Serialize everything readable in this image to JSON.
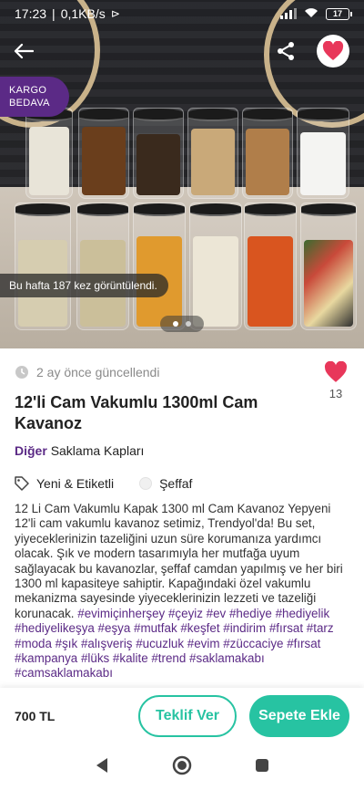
{
  "status_bar": {
    "time": "17:23",
    "speed": "0,1KB/s",
    "battery": "17"
  },
  "hero": {
    "badge_line1": "KARGO",
    "badge_line2": "BEDAVA",
    "views_text": "Bu hafta 187 kez görüntülendi.",
    "pages": 2,
    "current_page": 1
  },
  "product": {
    "updated": "2 ay önce güncellendi",
    "favorites": "13",
    "title": "12'li Cam Vakumlu 1300ml Cam Kavanoz",
    "category_main": "Diğer",
    "category_sub": "Saklama Kapları",
    "condition": "Yeni & Etiketli",
    "color": "Şeffaf",
    "description": "12 Li Cam Vakumlu Kapak 1300 ml Cam Kavanoz Yepyeni 12'li cam vakumlu kavanoz setimiz, Trendyol'da! Bu set, yiyeceklerinizin tazeliğini uzun süre korumanıza yardımcı olacak. Şık ve modern tasarımıyla her mutfağa uyum sağlayacak bu kavanozlar, şeffaf camdan yapılmış ve her biri 1300 ml kapasiteye sahiptir. Kapağındaki özel vakumlu mekanizma sayesinde yiyeceklerinizin lezzeti ve tazeliği korunacak.",
    "hashtags": "#evimiçinherşey #çeyiz #ev #hediye #hediyelik #hediyelikeşya #eşya #mutfak #keşfet #indirim #fırsat #tarz #moda #şık #alışveriş #ucuzluk #evim #züccaciye #fırsat #kampanya #lüks #kalite #trend #saklamakabı #camsaklamakabı"
  },
  "actions": {
    "price": "700 TL",
    "offer_label": "Teklif Ver",
    "cart_label": "Sepete Ekle"
  },
  "colors": {
    "accent": "#27c3a2",
    "brand": "#5b2a86",
    "heart": "#e8375a"
  }
}
